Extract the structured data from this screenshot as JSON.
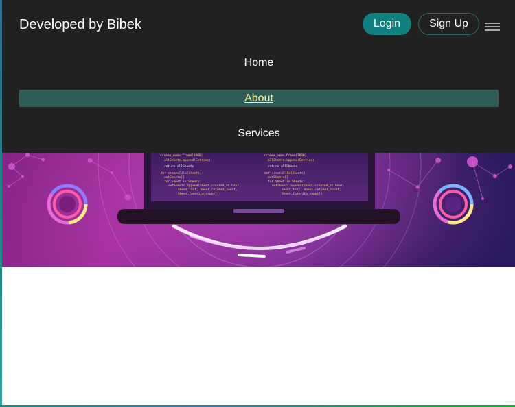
{
  "navbar": {
    "brand": "Developed by Bibek",
    "login_label": "Login",
    "signup_label": "Sign Up",
    "menu_icon": "hamburger-icon",
    "menu_items": [
      {
        "label": "Home",
        "active": false
      },
      {
        "label": "About",
        "active": true
      },
      {
        "label": "Services",
        "active": false
      }
    ]
  },
  "colors": {
    "navbar_bg": "#212121",
    "login_bg": "#0f7f7f",
    "active_item_bg": "#2f5d58",
    "active_item_text": "#f5f39a",
    "hero_purple": "#8e2a8c"
  },
  "hero": {
    "image": "laptop-code-illustration"
  }
}
